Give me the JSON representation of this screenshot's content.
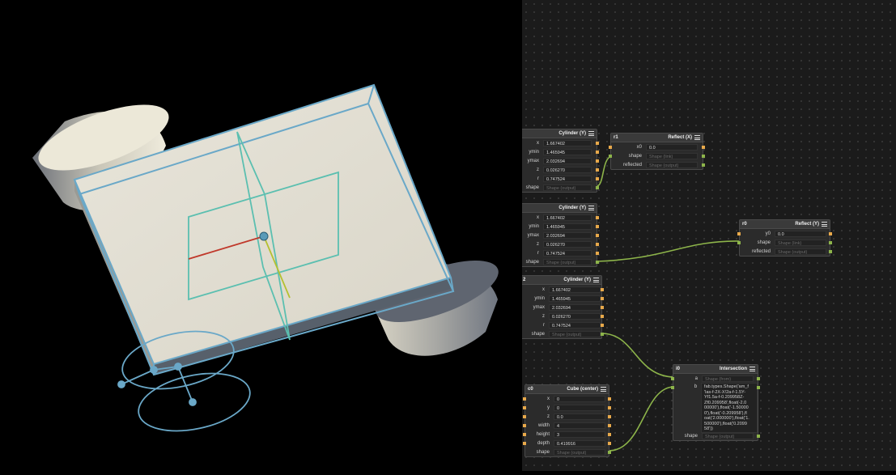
{
  "nodes": {
    "cyl0": {
      "id": "",
      "title": "Cylinder (Y)",
      "fields": [
        {
          "label": "x",
          "value": "1.667402"
        },
        {
          "label": "ymin",
          "value": "1.465945"
        },
        {
          "label": "ymax",
          "value": "2.032694"
        },
        {
          "label": "z",
          "value": "0.026270"
        },
        {
          "label": "r",
          "value": "0.747524"
        }
      ],
      "shape": {
        "label": "shape",
        "value": "Shape (output)"
      }
    },
    "cyl1": {
      "id": "",
      "title": "Cylinder (Y)",
      "fields": [
        {
          "label": "x",
          "value": "1.667402"
        },
        {
          "label": "ymin",
          "value": "1.465945"
        },
        {
          "label": "ymax",
          "value": "2.032694"
        },
        {
          "label": "z",
          "value": "0.026270"
        },
        {
          "label": "r",
          "value": "0.747524"
        }
      ],
      "shape": {
        "label": "shape",
        "value": "Shape (output)"
      }
    },
    "cyl2": {
      "id": "2",
      "title": "Cylinder (Y)",
      "fields": [
        {
          "label": "x",
          "value": "1.667402"
        },
        {
          "label": "ymin",
          "value": "1.465945"
        },
        {
          "label": "ymax",
          "value": "2.032694"
        },
        {
          "label": "z",
          "value": "0.026270"
        },
        {
          "label": "r",
          "value": "0.747524"
        }
      ],
      "shape": {
        "label": "shape",
        "value": "Shape (output)"
      }
    },
    "r1": {
      "id": "r1",
      "title": "Reflect (X)",
      "fields": [
        {
          "label": "x0",
          "value": "0.0"
        },
        {
          "label": "shape",
          "value": "Shape (link)"
        },
        {
          "label": "reflected",
          "value": "Shape (output)"
        }
      ]
    },
    "r0": {
      "id": "r0",
      "title": "Reflect (Y)",
      "fields": [
        {
          "label": "y0",
          "value": "0.0"
        },
        {
          "label": "shape",
          "value": "Shape (link)"
        },
        {
          "label": "reflected",
          "value": "Shape (output)"
        }
      ]
    },
    "c0": {
      "id": "c0",
      "title": "Cube (center)",
      "fields": [
        {
          "label": "x",
          "value": "0"
        },
        {
          "label": "y",
          "value": "0"
        },
        {
          "label": "z",
          "value": "0.0"
        },
        {
          "label": "width",
          "value": "4"
        },
        {
          "label": "height",
          "value": "3"
        },
        {
          "label": "depth",
          "value": "0.419916"
        }
      ],
      "shape": {
        "label": "shape",
        "value": "Shape (output)"
      }
    },
    "i0": {
      "id": "i0",
      "title": "Intersection",
      "a": {
        "label": "a",
        "value": "Shape (from)"
      },
      "b": {
        "label": "b",
        "value": "fab.types.Shape('am_f\n'las-f-2X-X!2a-f-1.5Y-\nYf1.5a-f-0.209958Z-\nZf0.209958',float(-2.0\n00000'),float('-1.50000\n0'),float('-0.209958'),fl\noat('2.000000'),float('1.\n500000'),float('0.2099\n58'))"
      },
      "shape": {
        "label": "shape",
        "value": "Shape (output)"
      }
    }
  },
  "colors": {
    "port_value": "#e8a94a",
    "port_shape": "#8db44a",
    "wire": "#8db44a",
    "wireframe": "#6aa8c8",
    "plane": "#5bbfb0",
    "body": "#e6e2d6"
  }
}
